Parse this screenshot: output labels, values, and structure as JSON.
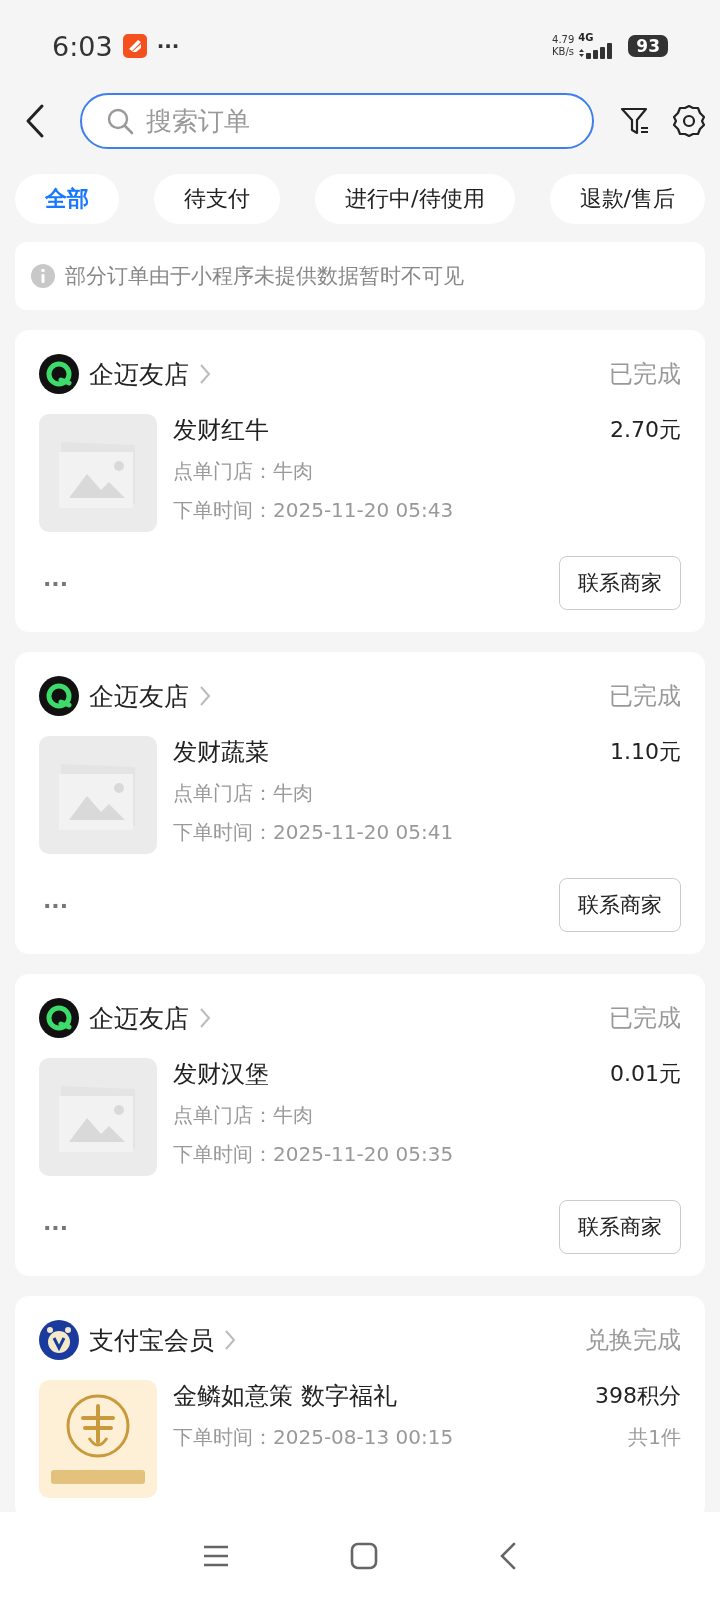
{
  "status_bar": {
    "time": "6:03",
    "more": "···",
    "net_speed": "4.79",
    "net_unit": "KB/s",
    "network": "4G",
    "battery": "93"
  },
  "search": {
    "placeholder": "搜索订单"
  },
  "tabs": [
    {
      "label": "全部",
      "selected": true
    },
    {
      "label": "待支付",
      "selected": false
    },
    {
      "label": "进行中/待使用",
      "selected": false
    },
    {
      "label": "退款/售后",
      "selected": false
    }
  ],
  "notice": {
    "text": "部分订单由于小程序未提供数据暂时不可见"
  },
  "orders": [
    {
      "shop": "企迈友店",
      "shop_logo": {
        "kind": "q"
      },
      "status": "已完成",
      "thumb": {
        "kind": "placeholder"
      },
      "title": "发财红牛",
      "price": "2.70元",
      "store": "点单门店：牛肉",
      "time": "下单时间：2025-11-20 05:43",
      "more": "···",
      "button": "联系商家"
    },
    {
      "shop": "企迈友店",
      "shop_logo": {
        "kind": "q"
      },
      "status": "已完成",
      "thumb": {
        "kind": "placeholder"
      },
      "title": "发财蔬菜",
      "price": "1.10元",
      "store": "点单门店：牛肉",
      "time": "下单时间：2025-11-20 05:41",
      "more": "···",
      "button": "联系商家"
    },
    {
      "shop": "企迈友店",
      "shop_logo": {
        "kind": "q"
      },
      "status": "已完成",
      "thumb": {
        "kind": "placeholder"
      },
      "title": "发财汉堡",
      "price": "0.01元",
      "store": "点单门店：牛肉",
      "time": "下单时间：2025-11-20 05:35",
      "more": "···",
      "button": "联系商家"
    },
    {
      "shop": "支付宝会员",
      "shop_logo": {
        "kind": "v"
      },
      "status": "兑换完成",
      "title": "金鳞如意策 数字福礼",
      "price": "398积分",
      "time": "下单时间：2025-08-13 00:15",
      "count": "共1件"
    }
  ]
}
